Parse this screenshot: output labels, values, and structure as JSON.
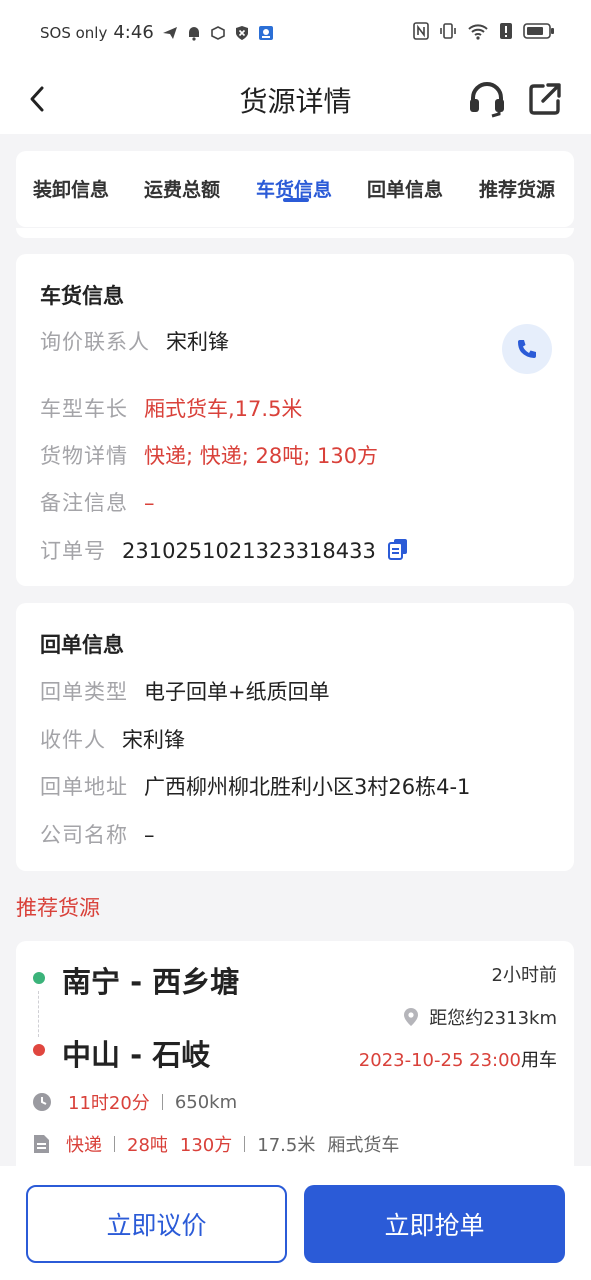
{
  "status_bar": {
    "carrier": "SOS only",
    "time": "4:46",
    "icons": [
      "send-icon",
      "bell-icon",
      "box-icon",
      "shield-icon",
      "app-icon",
      "nfc-icon",
      "vibrate-icon",
      "wifi-icon",
      "alert-icon",
      "battery-icon"
    ]
  },
  "nav": {
    "title": "货源详情",
    "back_icon": "chevron-left-icon",
    "service_icon": "headset-icon",
    "share_icon": "share-icon"
  },
  "tabs": [
    {
      "label": "装卸信息",
      "active": false
    },
    {
      "label": "运费总额",
      "active": false
    },
    {
      "label": "车货信息",
      "active": true
    },
    {
      "label": "回单信息",
      "active": false
    },
    {
      "label": "推荐货源",
      "active": false
    }
  ],
  "cargo_info": {
    "title": "车货信息",
    "contact_label": "询价联系人",
    "contact_value": "宋利锋",
    "vehicle_label": "车型车长",
    "vehicle_value": "厢式货车,17.5米",
    "goods_label": "货物详情",
    "goods_value": "快递; 快递; 28吨; 130方",
    "remark_label": "备注信息",
    "remark_value": "–",
    "order_label": "订单号",
    "order_value": "2310251021323318433"
  },
  "receipt_info": {
    "title": "回单信息",
    "type_label": "回单类型",
    "type_value": "电子回单+纸质回单",
    "receiver_label": "收件人",
    "receiver_value": "宋利锋",
    "address_label": "回单地址",
    "address_value": "广西柳州柳北胜利小区3村26栋4-1",
    "company_label": "公司名称",
    "company_value": "–"
  },
  "recommend": {
    "heading": "推荐货源",
    "from": "南宁 - 西乡塘",
    "to": "中山 - 石岐",
    "time_ago": "2小时前",
    "distance": "距您约2313km",
    "date": "2023-10-25 23:00",
    "date_suffix": "用车",
    "duration": "11时20分",
    "route_km": "650km",
    "goods_type": "快递",
    "weight": "28吨",
    "volume": "130方",
    "length": "17.5米",
    "truck_type": "厢式货车"
  },
  "actions": {
    "negotiate": "立即议价",
    "grab": "立即抢单"
  },
  "colors": {
    "primary": "#2b5bd7",
    "danger": "#d9413a",
    "label_gray": "#a4a4a8",
    "page_bg": "#f4f4f6"
  }
}
